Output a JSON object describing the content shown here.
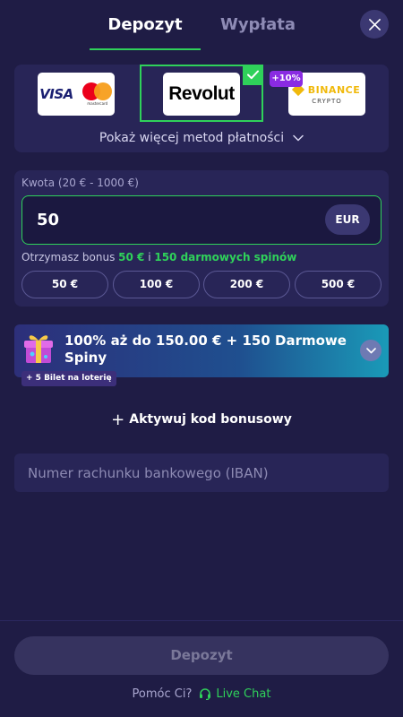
{
  "tabs": {
    "deposit": "Depozyt",
    "withdrawal": "Wypłata"
  },
  "icons": {
    "close": "close-icon",
    "check": "check-icon",
    "chevron": "chevron-down-icon",
    "gift": "gift-icon",
    "plus": "plus-icon",
    "headset": "headset-icon"
  },
  "methods": {
    "cards": {
      "visa": "VISA",
      "mastercard": "mastercard"
    },
    "revolut": "Revolut",
    "binance": {
      "name": "BINANCE",
      "sub": "CRYPTO"
    },
    "promo_badge": "+10%",
    "show_more": "Pokaż więcej metod płatności"
  },
  "amount": {
    "label": "Kwota (20 € - 1000 €)",
    "value": "50",
    "currency": "EUR",
    "bonus_prefix": "Otrzymasz bonus ",
    "bonus_amount": "50 €",
    "bonus_join": " i ",
    "bonus_spins": "150 darmowych spinów",
    "quick_options": [
      "50 €",
      "100 €",
      "200 €",
      "500 €"
    ]
  },
  "bonus": {
    "title": "100% aż do 150.00 € + 150 Darmowe Spiny",
    "lottery": "+ 5 Bilet na loterię"
  },
  "activate_code": "Aktywuj kod bonusowy",
  "iban_placeholder": "Numer rachunku bankowego (IBAN)",
  "submit": "Depozyt",
  "help": {
    "text": "Pomóc Ci?",
    "chat": "Live Chat"
  },
  "colors": {
    "background": "#1f1c45",
    "panel": "#282557",
    "accent_green": "#2fd15a",
    "promo_purple": "#8a2be2"
  }
}
